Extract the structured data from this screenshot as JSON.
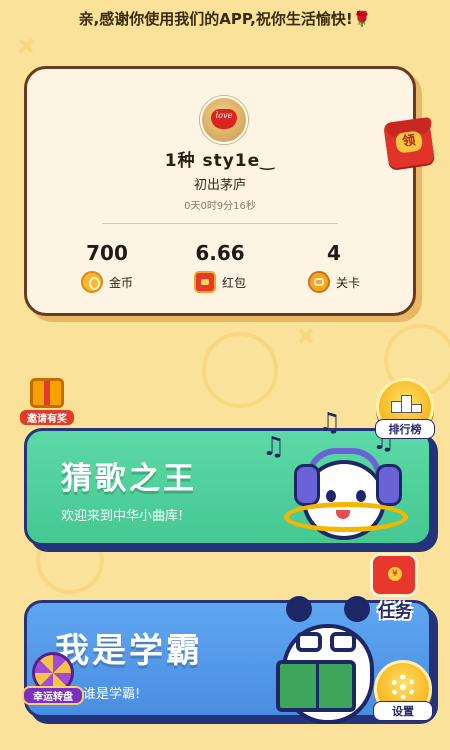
{
  "banner": {
    "message": "亲,感谢你使用我们的APP,祝你生活愉快!",
    "rose": "🌹"
  },
  "profile": {
    "avatar_text": "love",
    "username": "1种 sty1e‿",
    "rank_title": "初出茅庐",
    "play_time": "0天0时9分16秒"
  },
  "claim_button": {
    "label": "领"
  },
  "stats": [
    {
      "value": "700",
      "label": "金币",
      "icon": "coin-icon"
    },
    {
      "value": "6.66",
      "label": "红包",
      "icon": "hongbao-icon"
    },
    {
      "value": "4",
      "label": "关卡",
      "icon": "level-icon"
    }
  ],
  "invite": {
    "label": "邀请有奖"
  },
  "leaderboard": {
    "label": "排行榜"
  },
  "modes": [
    {
      "title": "猜歌之王",
      "subtitle": "欢迎来到中华小曲库!"
    },
    {
      "title": "我是学霸",
      "subtitle": "谁是学霸!"
    }
  ],
  "tasks": {
    "label": "任务"
  },
  "lucky_wheel": {
    "label": "幸运转盘"
  },
  "settings": {
    "label": "设置"
  },
  "colors": {
    "background": "#fbe29a",
    "card": "#fdf4e3",
    "mode1": "#5cd9a6",
    "mode2": "#5fa6f0",
    "navy": "#25337a"
  }
}
